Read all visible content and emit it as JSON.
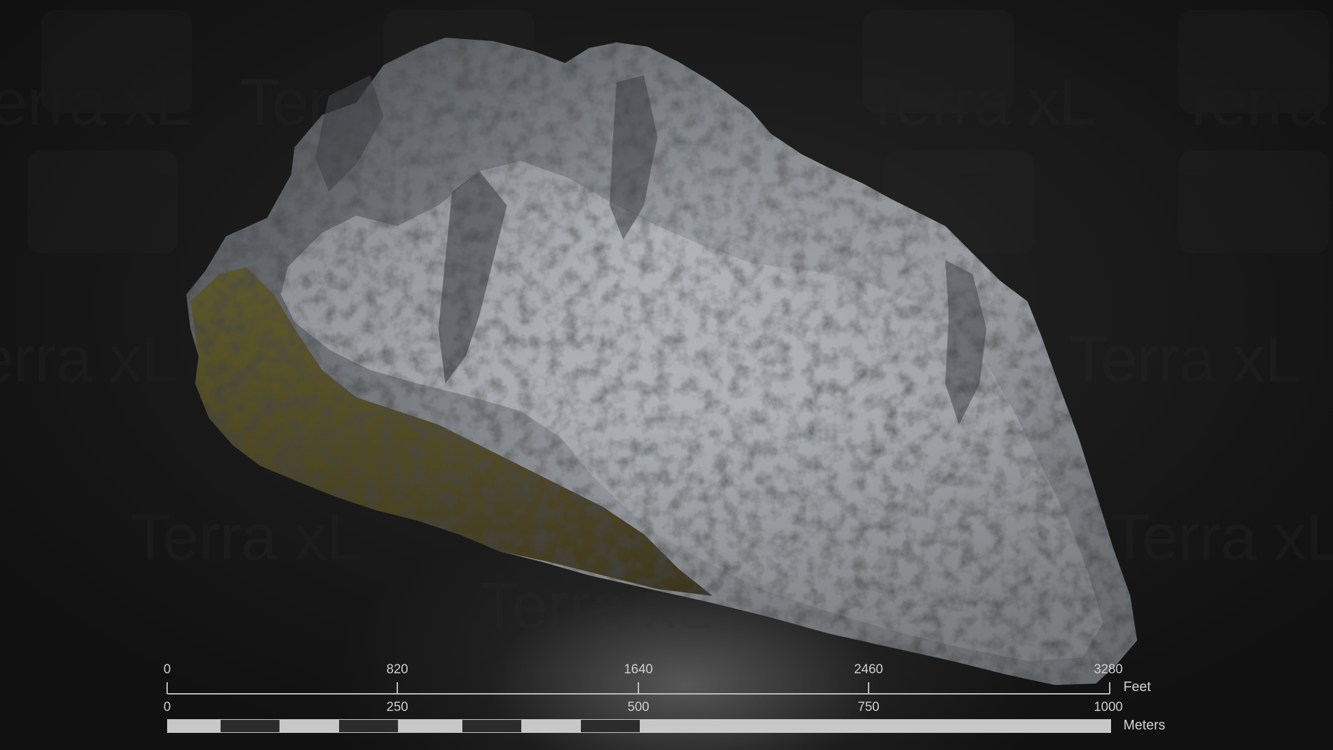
{
  "watermark": {
    "text": "Terra xL"
  },
  "scale_bar": {
    "feet": {
      "unit": "Feet",
      "ticks": [
        "0",
        "820",
        "1640",
        "2460",
        "3280"
      ]
    },
    "meters": {
      "unit": "Meters",
      "ticks": [
        "0",
        "250",
        "500",
        "750",
        "1000"
      ]
    }
  },
  "colors": {
    "background": "#151515",
    "rock": "#8e9296",
    "snow": "#c9cdd2",
    "moss": "#6e6a2c",
    "scale_light": "#c8c8c8",
    "scale_dark": "#2c2c2c"
  }
}
